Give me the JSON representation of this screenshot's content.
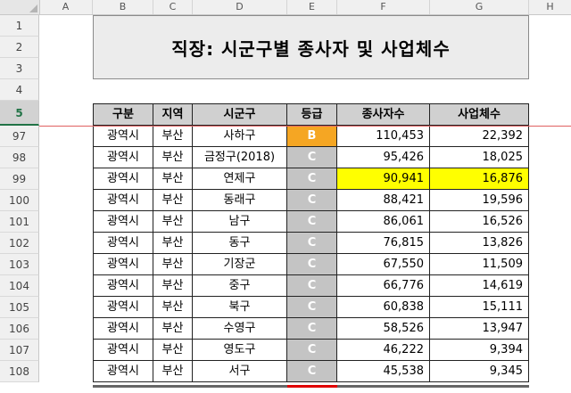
{
  "columns": [
    "A",
    "B",
    "C",
    "D",
    "E",
    "F",
    "G",
    "H"
  ],
  "title": "직장: 시군구별 종사자 및 사업체수",
  "header_rows": [
    "1",
    "2",
    "3",
    "4",
    "5"
  ],
  "table_header": [
    "구분",
    "지역",
    "시군구",
    "등급",
    "종사자수",
    "사업체수"
  ],
  "rows": [
    {
      "row": "97",
      "cat": "광역시",
      "region": "부산",
      "district": "사하구",
      "grade": "B",
      "workers": "110,453",
      "firms": "22,392"
    },
    {
      "row": "98",
      "cat": "광역시",
      "region": "부산",
      "district": "금정구(2018)",
      "grade": "C",
      "workers": "95,426",
      "firms": "18,025"
    },
    {
      "row": "99",
      "cat": "광역시",
      "region": "부산",
      "district": "연제구",
      "grade": "C",
      "workers": "90,941",
      "firms": "16,876"
    },
    {
      "row": "100",
      "cat": "광역시",
      "region": "부산",
      "district": "동래구",
      "grade": "C",
      "workers": "88,421",
      "firms": "19,596"
    },
    {
      "row": "101",
      "cat": "광역시",
      "region": "부산",
      "district": "남구",
      "grade": "C",
      "workers": "86,061",
      "firms": "16,526"
    },
    {
      "row": "102",
      "cat": "광역시",
      "region": "부산",
      "district": "동구",
      "grade": "C",
      "workers": "76,815",
      "firms": "13,826"
    },
    {
      "row": "103",
      "cat": "광역시",
      "region": "부산",
      "district": "기장군",
      "grade": "C",
      "workers": "67,550",
      "firms": "11,509"
    },
    {
      "row": "104",
      "cat": "광역시",
      "region": "부산",
      "district": "중구",
      "grade": "C",
      "workers": "66,776",
      "firms": "14,619"
    },
    {
      "row": "105",
      "cat": "광역시",
      "region": "부산",
      "district": "북구",
      "grade": "C",
      "workers": "60,838",
      "firms": "15,111"
    },
    {
      "row": "106",
      "cat": "광역시",
      "region": "부산",
      "district": "수영구",
      "grade": "C",
      "workers": "58,526",
      "firms": "13,947"
    },
    {
      "row": "107",
      "cat": "광역시",
      "region": "부산",
      "district": "영도구",
      "grade": "C",
      "workers": "46,222",
      "firms": "9,394"
    },
    {
      "row": "108",
      "cat": "광역시",
      "region": "부산",
      "district": "서구",
      "grade": "C",
      "workers": "45,538",
      "firms": "9,345"
    }
  ],
  "highlight_row": "99",
  "colors": {
    "grade_b": "#f5a623",
    "grade_c": "#c4c4c4",
    "highlight": "#ffff00",
    "header_bg": "#d0d0d0",
    "selected_row_text": "#217346"
  }
}
